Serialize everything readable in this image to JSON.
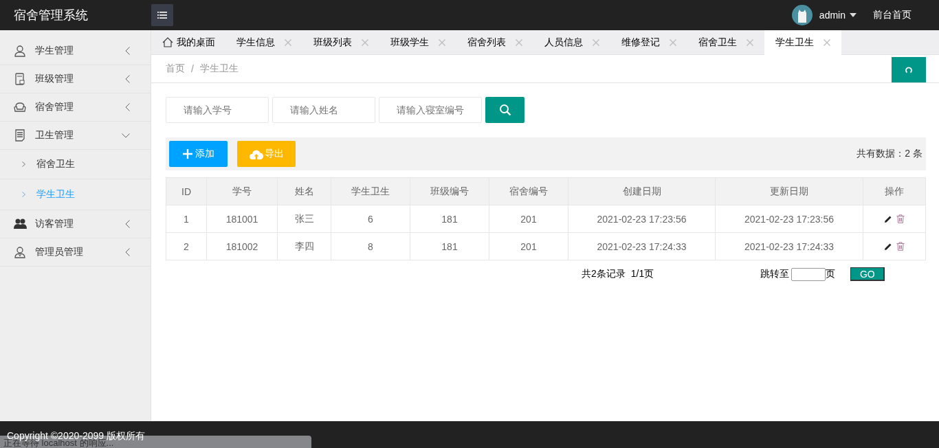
{
  "header": {
    "title": "宿舍管理系统",
    "user": "admin",
    "home_link": "前台首页"
  },
  "sidebar": {
    "items": [
      {
        "label": "学生管理",
        "expanded": false
      },
      {
        "label": "班级管理",
        "expanded": false
      },
      {
        "label": "宿舍管理",
        "expanded": false
      },
      {
        "label": "卫生管理",
        "expanded": true,
        "children": [
          {
            "label": "宿舍卫生",
            "selected": false
          },
          {
            "label": "学生卫生",
            "selected": true
          }
        ]
      },
      {
        "label": "访客管理",
        "expanded": false
      },
      {
        "label": "管理员管理",
        "expanded": false
      }
    ]
  },
  "tabs": [
    {
      "label": "我的桌面",
      "closable": false,
      "selected": false
    },
    {
      "label": "学生信息",
      "closable": true,
      "selected": false
    },
    {
      "label": "班级列表",
      "closable": true,
      "selected": false
    },
    {
      "label": "班级学生",
      "closable": true,
      "selected": false
    },
    {
      "label": "宿舍列表",
      "closable": true,
      "selected": false
    },
    {
      "label": "人员信息",
      "closable": true,
      "selected": false
    },
    {
      "label": "维修登记",
      "closable": true,
      "selected": false
    },
    {
      "label": "宿舍卫生",
      "closable": true,
      "selected": false
    },
    {
      "label": "学生卫生",
      "closable": true,
      "selected": true
    }
  ],
  "breadcrumb": {
    "items": [
      "首页",
      "学生卫生"
    ],
    "separator": "/"
  },
  "search": {
    "fields": [
      {
        "placeholder": "请输入学号"
      },
      {
        "placeholder": "请输入姓名"
      },
      {
        "placeholder": "请输入寝室编号"
      }
    ]
  },
  "toolbar": {
    "buttons": [
      {
        "label": "添加",
        "kind": "add"
      },
      {
        "label": "导出",
        "kind": "export"
      }
    ],
    "total": "共有数据：2 条"
  },
  "table": {
    "columns": [
      "ID",
      "学号",
      "姓名",
      "学生卫生",
      "班级编号",
      "宿舍编号",
      "创建日期",
      "更新日期",
      "操作"
    ],
    "rows": [
      [
        "1",
        "181001",
        "张三",
        "6",
        "181",
        "201",
        "2021-02-23 17:23:56",
        "2021-02-23 17:23:56"
      ],
      [
        "2",
        "181002",
        "李四",
        "8",
        "181",
        "201",
        "2021-02-23 17:24:33",
        "2021-02-23 17:24:33"
      ]
    ]
  },
  "pagination": {
    "record_count": "共2条记录",
    "page_info": "1/1页",
    "jump_label": "跳转至",
    "page_unit": "页",
    "go": "GO"
  },
  "footer": {
    "copyright": "Copyright ©2020-2099 版权所有"
  },
  "browser_status": "正在等待 localhost 的响应..."
}
